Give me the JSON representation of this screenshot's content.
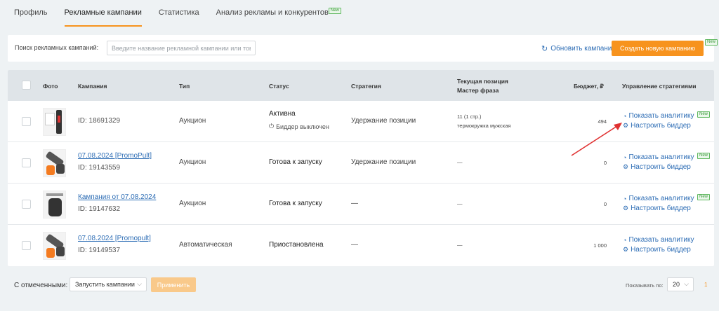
{
  "tabs": [
    {
      "label": "Профиль"
    },
    {
      "label": "Рекламные кампании",
      "active": true
    },
    {
      "label": "Статистика"
    },
    {
      "label": "Анализ рекламы и конкурентов",
      "badge": "New"
    }
  ],
  "search": {
    "label": "Поиск рекламных кампаний:",
    "placeholder": "Введите название рекламной кампании или товар",
    "value": ""
  },
  "refresh_label": "Обновить кампании",
  "create_button": {
    "label": "Создать новую кампанию",
    "badge": "New"
  },
  "table": {
    "headers": {
      "photo": "Фото",
      "campaign": "Кампания",
      "type": "Тип",
      "status": "Статус",
      "strategy": "Стратегия",
      "position_line1": "Текущая позиция",
      "position_line2": "Мастер фраза",
      "budget": "Бюджет, ₽",
      "manage": "Управление стратегиями"
    },
    "rows": [
      {
        "name": "",
        "id": "ID: 18691329",
        "type": "Аукцион",
        "status": "Активна",
        "bidder": "Биддер выключен",
        "strategy": "Удержание позиции",
        "position": "11 (1 стр.)",
        "phrase": "термокружка мужская",
        "budget": "494",
        "analytics": "Показать аналитику",
        "analytics_badge": "New",
        "bidder_link": "Настроить биддер"
      },
      {
        "name": "07.08.2024 [PromoPult]",
        "id": "ID: 19143559",
        "type": "Аукцион",
        "status": "Готова к запуску",
        "strategy": "Удержание позиции",
        "position": "—",
        "budget": "0",
        "analytics": "Показать аналитику",
        "analytics_badge": "New",
        "bidder_link": "Настроить биддер"
      },
      {
        "name": "Кампания от 07.08.2024",
        "id": "ID: 19147632",
        "type": "Аукцион",
        "status": "Готова к запуску",
        "strategy": "—",
        "position": "—",
        "budget": "0",
        "analytics": "Показать аналитику",
        "analytics_badge": "New",
        "bidder_link": "Настроить биддер"
      },
      {
        "name": "07.08.2024 [Promopult]",
        "id": "ID: 19149537",
        "type": "Автоматическая",
        "status": "Приостановлена",
        "strategy": "—",
        "position": "—",
        "budget": "1 000",
        "analytics": "Показать аналитику",
        "bidder_link": "Настроить биддер"
      }
    ]
  },
  "footer": {
    "selected_label": "С отмеченными:",
    "action_select": "Запустить кампании",
    "apply_label": "Применить",
    "show_label": "Показывать по:",
    "per_page": "20",
    "page": "1"
  },
  "colors": {
    "accent": "#f7931e",
    "link": "#2d6db5",
    "header_bg": "#dfe4e8",
    "arrow": "#e03030"
  },
  "icons": {
    "refresh": "refresh-icon",
    "analytics": "analytics-icon",
    "settings": "gear-icon",
    "bidder_off": "power-icon"
  }
}
